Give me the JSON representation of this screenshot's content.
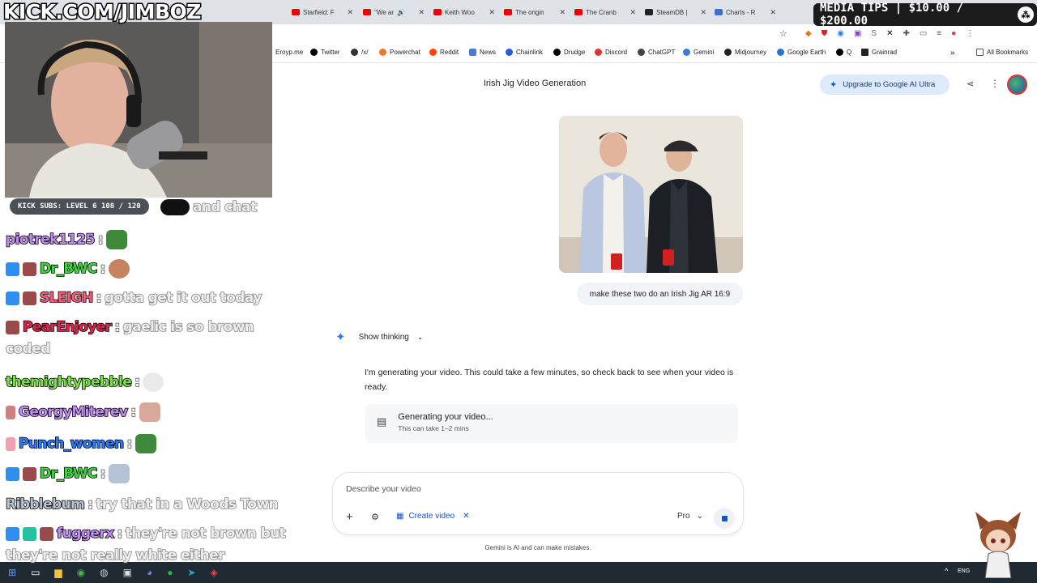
{
  "stream": {
    "channel_logo": "KICK.COM/JIMBOZ",
    "media_tips": "MEDIA TIPS | $10.00 / $200.00",
    "subs_bar": "KICK SUBS: LEVEL 6 108 / 120",
    "and_chat": "and chat"
  },
  "chat": [
    {
      "user": "piotrek1125",
      "msg": "",
      "color": "#c18cf2"
    },
    {
      "user": "Dr_BWC",
      "msg": "",
      "color": "#3ad63a"
    },
    {
      "user": "SLEIGH",
      "msg": "gotta get it out today",
      "color": "#ff5c7a"
    },
    {
      "user": "PearEnjoyer",
      "msg": "gaelic is so brown",
      "msg2": "coded",
      "color": "#e0254d"
    },
    {
      "user": "themightypebble",
      "msg": "",
      "color": "#7be04a"
    },
    {
      "user": "GeorgyMiterev",
      "msg": "",
      "color": "#c18cf2"
    },
    {
      "user": "Punch_women",
      "msg": "",
      "color": "#2c7cff"
    },
    {
      "user": "Dr_BWC",
      "msg": "",
      "color": "#3ad63a"
    },
    {
      "user": "Ribblebum",
      "msg": "try that in a Woods Town",
      "color": "#b9c6d6"
    },
    {
      "user": "fuggerx",
      "msg": "they're not brown but",
      "msg2": "they're not really white either",
      "color": "#c18cf2"
    }
  ],
  "browser": {
    "tabs": [
      {
        "label": "Starfield: F"
      },
      {
        "label": "\"We ar"
      },
      {
        "label": "Keith Woo"
      },
      {
        "label": "The origin"
      },
      {
        "label": "The Cranb"
      },
      {
        "label": "SteamDB |"
      },
      {
        "label": "Charts - R"
      }
    ],
    "bookmarks": [
      "Eroyp.me",
      "Twitter",
      "/x/",
      "Powerchat",
      "Reddit",
      "News",
      "Chainlink",
      "Drudge",
      "Discord",
      "ChatGPT",
      "Gemini",
      "Midjourney",
      "Google Earth",
      "Q",
      "Grainrad"
    ],
    "all_bookmarks": "All Bookmarks"
  },
  "gemini": {
    "title": "Irish Jig Video Generation",
    "upgrade": "Upgrade to Google AI Ultra",
    "user_prompt": "make these two do an Irish Jig AR 16:9",
    "show_thinking": "Show thinking",
    "reply": "I'm generating your video. This could take a few minutes, so check back to see when your video is ready.",
    "gen_title": "Generating your video...",
    "gen_sub": "This can take 1–2 mins",
    "input_placeholder": "Describe your video",
    "create_video": "Create video",
    "model": "Pro",
    "disclaimer": "Gemini is AI and can make mistakes."
  },
  "taskbar": {
    "lang": "ENG"
  },
  "colors": {
    "accent_blue": "#0b57d0",
    "upgrade_bg": "#ddeafb",
    "bubble_bg": "#f0f4f9"
  }
}
